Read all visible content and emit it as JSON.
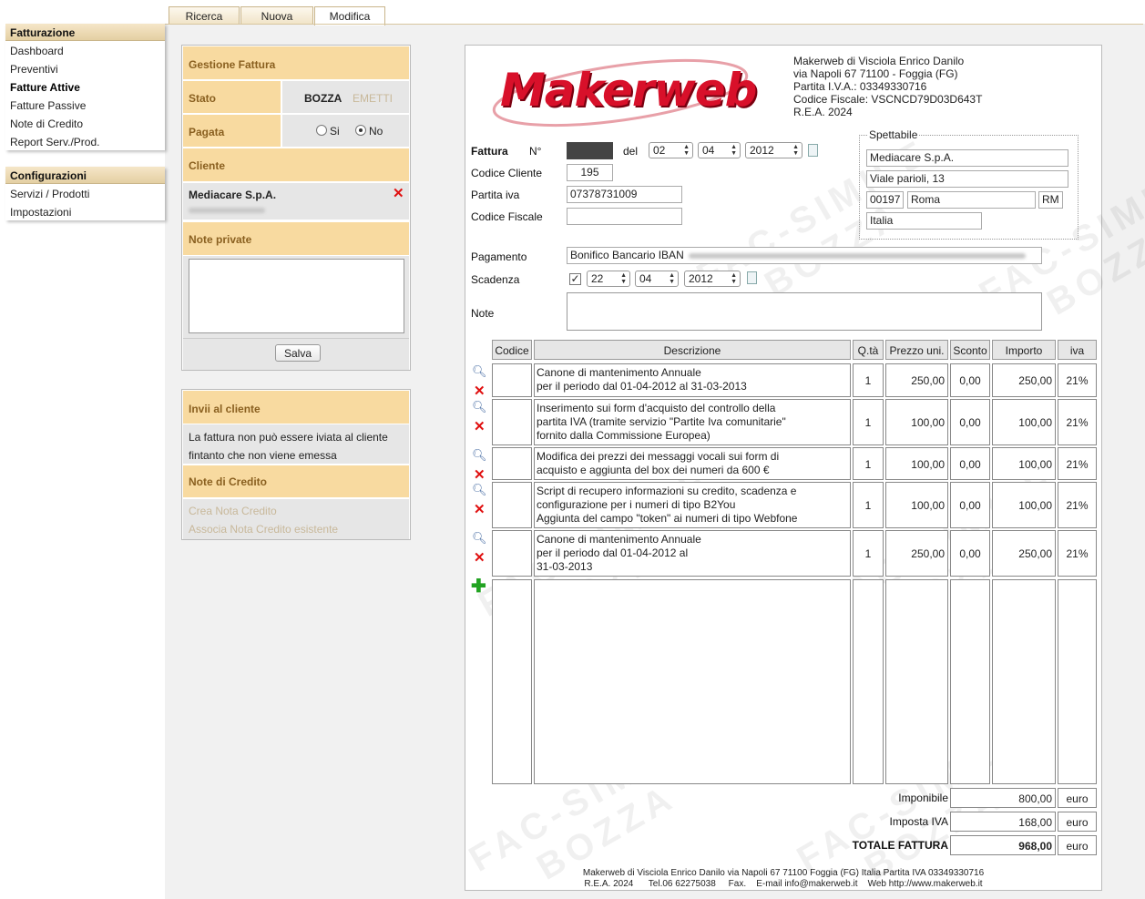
{
  "tabs": [
    "Ricerca",
    "Nuova",
    "Modifica"
  ],
  "sidebar": {
    "section1_title": "Fatturazione",
    "section1_items": [
      "Dashboard",
      "Preventivi",
      "Fatture Attive",
      "Fatture Passive",
      "Note di Credito",
      "Report Serv./Prod."
    ],
    "section2_title": "Configurazioni",
    "section2_items": [
      "Servizi / Prodotti",
      "Impostazioni"
    ]
  },
  "gestione": {
    "title": "Gestione Fattura",
    "stato_label": "Stato",
    "stato_value": "BOZZA",
    "stato_action": "EMETTI",
    "pagata_label": "Pagata",
    "opt_si": "Si",
    "opt_no": "No",
    "cliente_label": "Cliente",
    "cliente_name": "Mediacare S.p.A.",
    "note_private_label": "Note private",
    "save_label": "Salva"
  },
  "invii": {
    "title": "Invii al cliente",
    "message": "La fattura non può essere iviata al cliente fintanto che non viene emessa",
    "nc_title": "Note di Credito",
    "crea_label": "Crea Nota Credito",
    "associa_label": "Associa Nota Credito esistente"
  },
  "company": {
    "logo_text": "Makerweb",
    "lines": [
      "Makerweb di Visciola Enrico Danilo",
      "via Napoli 67 71100 - Foggia (FG)",
      "Partita I.V.A.: 03349330716",
      "Codice Fiscale: VSCNCD79D03D643T",
      "R.E.A. 2024"
    ]
  },
  "invoice": {
    "fattura_label": "Fattura",
    "numero_label": "N°",
    "del_label": "del",
    "day": "02",
    "month": "04",
    "year": "2012",
    "codice_cliente_label": "Codice Cliente",
    "codice_cliente": "195",
    "partita_iva_label": "Partita iva",
    "partita_iva": "07378731009",
    "codice_fiscale_label": "Codice Fiscale",
    "codice_fiscale": "",
    "spettabile_label": "Spettabile",
    "sp_name": "Mediacare S.p.A.",
    "sp_address": "Viale parioli, 13",
    "sp_cap": "00197",
    "sp_city": "Roma",
    "sp_prov": "RM",
    "sp_country": "Italia",
    "pagamento_label": "Pagamento",
    "pagamento": "Bonifico Bancario IBAN",
    "scadenza_label": "Scadenza",
    "sc_day": "22",
    "sc_month": "04",
    "sc_year": "2012",
    "note_label": "Note"
  },
  "table": {
    "headers": [
      "Codice",
      "Descrizione",
      "Q.tà",
      "Prezzo uni.",
      "Sconto",
      "Importo",
      "iva"
    ],
    "rows": [
      {
        "desc": [
          "Canone di mantenimento Annuale",
          "per il periodo dal 01-04-2012 al 31-03-2013"
        ],
        "qty": "1",
        "price": "250,00",
        "discount": "0,00",
        "amount": "250,00",
        "iva": "21%"
      },
      {
        "desc": [
          "Inserimento sui form d'acquisto del controllo della",
          "partita IVA (tramite servizio \"Partite Iva comunitarie\"",
          "fornito dalla Commissione Europea)"
        ],
        "qty": "1",
        "price": "100,00",
        "discount": "0,00",
        "amount": "100,00",
        "iva": "21%"
      },
      {
        "desc": [
          "Modifica dei prezzi dei messaggi vocali sui form di",
          "acquisto e aggiunta del box dei numeri da 600 €"
        ],
        "qty": "1",
        "price": "100,00",
        "discount": "0,00",
        "amount": "100,00",
        "iva": "21%"
      },
      {
        "desc": [
          "Script di recupero informazioni su credito, scadenza e",
          "configurazione per i numeri di tipo B2You",
          "Aggiunta del campo \"token\" ai numeri di tipo Webfone"
        ],
        "qty": "1",
        "price": "100,00",
        "discount": "0,00",
        "amount": "100,00",
        "iva": "21%"
      },
      {
        "desc": [
          "Canone di mantenimento Annuale",
          "per il periodo dal 01-04-2012 al",
          "31-03-2013"
        ],
        "qty": "1",
        "price": "250,00",
        "discount": "0,00",
        "amount": "250,00",
        "iva": "21%"
      }
    ]
  },
  "totals": {
    "imponibile_label": "Imponibile",
    "imponibile": "800,00",
    "iva_label": "Imposta IVA",
    "iva": "168,00",
    "totale_label": "TOTALE FATTURA",
    "totale": "968,00",
    "currency": "euro"
  },
  "watermark": {
    "line1": "FAC-SIMILE",
    "line2": "BOZZA"
  },
  "footer": {
    "line1": "Makerweb di Visciola Enrico Danilo via Napoli 67 71100 Foggia (FG) Italia   Partita IVA 03349330716",
    "line2": "R.E.A. 2024      Tel.06 62275038     Fax.    E-mail info@makerweb.it    Web http://www.makerweb.it"
  },
  "colors": {
    "accent": "#f8daa0",
    "accent_text": "#8a6020",
    "logo": "#d8102a",
    "delete": "#e01010",
    "add": "#22a322"
  }
}
